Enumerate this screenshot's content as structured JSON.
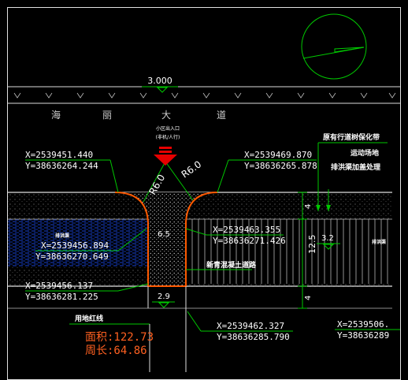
{
  "road": {
    "width_label": "3.000",
    "chars": [
      "海",
      "丽",
      "大",
      "道"
    ]
  },
  "entrance": {
    "note_line1": "小区出入口",
    "note_line2": "(非机/人行)"
  },
  "radius_labels": [
    "R6.0",
    "R6.0"
  ],
  "coords": {
    "c1": {
      "x": "X=2539451.440",
      "y": "Y=38636264.244"
    },
    "c2": {
      "x": "X=2539469.870",
      "y": "Y=38636265.878"
    },
    "c3": {
      "x": "X=2539456.894",
      "y": "Y=38636270.649"
    },
    "c4": {
      "x": "X=2539463.355",
      "y": "Y=38636271.426"
    },
    "c5": {
      "x": "X=2539456.137",
      "y": "Y=38636281.225"
    },
    "c6": {
      "x": "X=2539462.327",
      "y": "Y=38636285.790"
    },
    "c7": {
      "x": "X=2539506.",
      "y": "Y=38636289"
    }
  },
  "notes": {
    "right1": "原有行道树保化带",
    "right2": "运动场地",
    "right3": "排洪渠加盖处理",
    "concrete": "新青混凝土道路",
    "left_area": "排洪渠",
    "right_area": "排洪渠",
    "land_line": "用地红线"
  },
  "dims": {
    "d_65": "6.5",
    "d_125": "12.5",
    "d_4a": "4",
    "d_4b": "4",
    "d_32": "3.2",
    "d_29": "2.9"
  },
  "area": {
    "area_label": "面积:122.73",
    "perimeter_label": "周长:64.86"
  },
  "colors": {
    "line_green": "#00c800",
    "text_white": "#ffffff",
    "boundary_orange": "#ff5a00",
    "arrow_red": "#e60000",
    "text_orange": "#ff6020",
    "blue_hatch": "#1e50ff"
  }
}
